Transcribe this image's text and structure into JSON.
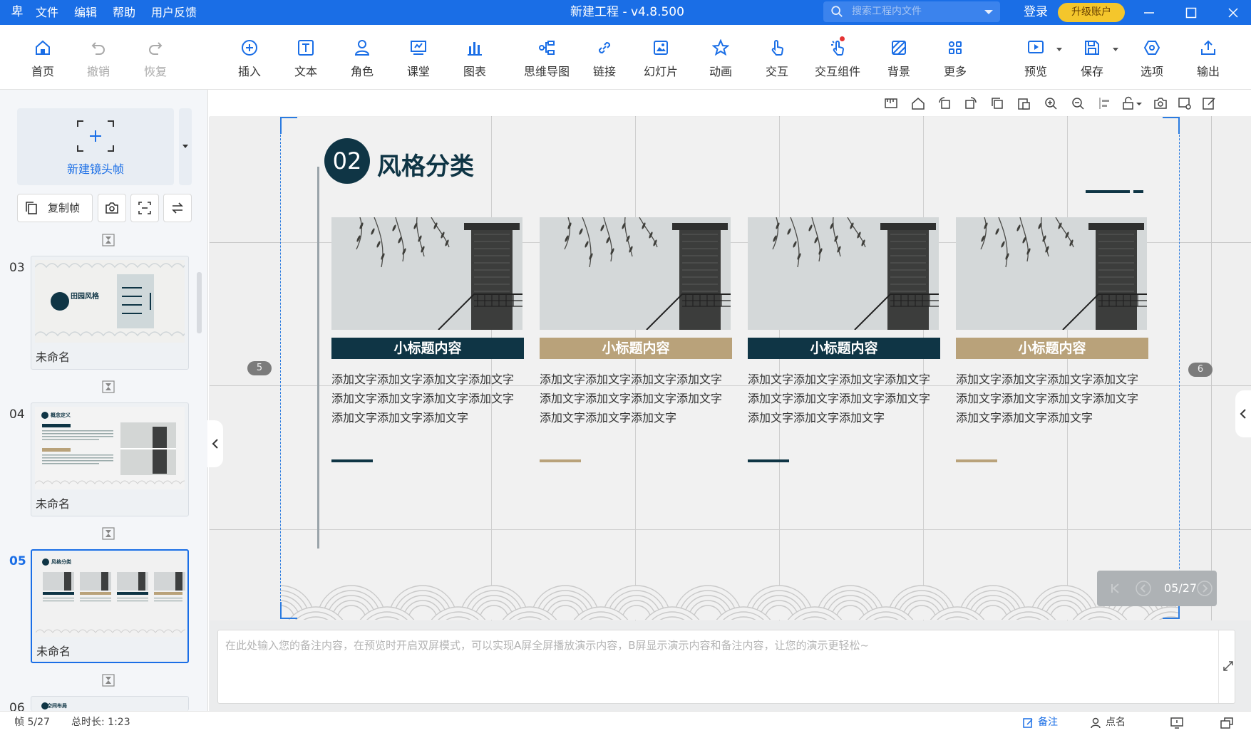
{
  "titlebar": {
    "logo": "卑",
    "menu": [
      "文件",
      "编辑",
      "帮助",
      "用户反馈"
    ],
    "title": "新建工程 - v4.8.500",
    "search_placeholder": "搜索工程内文件",
    "login": "登录",
    "upgrade": "升级账户",
    "accent_color": "#1a6ee6"
  },
  "toolbar": {
    "home": "首页",
    "undo": "撤销",
    "redo": "恢复",
    "insert": "插入",
    "text": "文本",
    "role": "角色",
    "classroom": "课堂",
    "chart": "图表",
    "mindmap": "思维导图",
    "link": "链接",
    "slides": "幻灯片",
    "animation": "动画",
    "interact": "交互",
    "interact_widget": "交互组件",
    "background": "背景",
    "more": "更多",
    "preview": "预览",
    "save": "保存",
    "options": "选项",
    "export": "输出"
  },
  "leftpanel": {
    "new_frame": "新建镜头帧",
    "copy_frame": "复制帧",
    "frames": [
      {
        "num": "03",
        "name": "未命名",
        "thumb_title": "田园风格"
      },
      {
        "num": "04",
        "name": "未命名",
        "thumb_title": "概念定义"
      },
      {
        "num": "05",
        "name": "未命名",
        "thumb_title": "风格分类"
      },
      {
        "num": "06",
        "name": "",
        "thumb_title": "空间布局"
      }
    ]
  },
  "slide": {
    "number": "02",
    "heading": "风格分类",
    "prev_chip": "5",
    "next_chip": "6",
    "cards": [
      {
        "title": "小标题内容",
        "color": "#0f3545",
        "lines": [
          "添加文字添加文字添加文字添加文字",
          "添加文字添加文字添加文字添加文字",
          "添加文字添加文字添加文字"
        ]
      },
      {
        "title": "小标题内容",
        "color": "#b9a27a",
        "lines": [
          "添加文字添加文字添加文字添加文字",
          "添加文字添加文字添加文字添加文字",
          "添加文字添加文字添加文字"
        ]
      },
      {
        "title": "小标题内容",
        "color": "#0f3545",
        "lines": [
          "添加文字添加文字添加文字添加文字",
          "添加文字添加文字添加文字添加文字",
          "添加文字添加文字添加文字"
        ]
      },
      {
        "title": "小标题内容",
        "color": "#b9a27a",
        "lines": [
          "添加文字添加文字添加文字添加文字",
          "添加文字添加文字添加文字添加文字",
          "添加文字添加文字添加文字"
        ]
      }
    ]
  },
  "pager": {
    "text": "05/27"
  },
  "notes": {
    "placeholder": "在此处输入您的备注内容，在预览时开启双屏模式，可以实现A屏全屏播放演示内容，B屏显示演示内容和备注内容，让您的演示更轻松~"
  },
  "statusbar": {
    "frame": "帧 5/27",
    "duration": "总时长: 1:23",
    "notes": "备注",
    "rollcall": "点名"
  }
}
